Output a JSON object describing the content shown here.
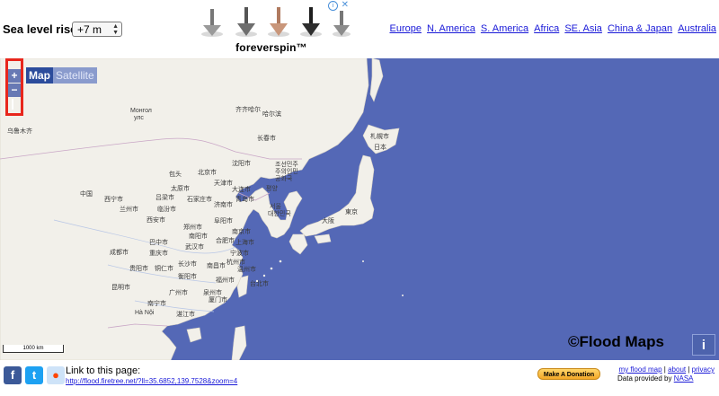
{
  "header": {
    "sea_level_label": "Sea level rise:",
    "sea_level_value": "+7 m",
    "ad_brand": "foreverspin™",
    "regions": [
      "Europe",
      "N. America",
      "S. America",
      "Africa",
      "SE. Asia",
      "China & Japan",
      "Australia"
    ]
  },
  "map": {
    "zoom_in": "+",
    "zoom_out": "−",
    "type_map": "Map",
    "type_satellite": "Satellite",
    "scale_label": "1000 km",
    "watermark": "©Flood Maps",
    "info": "i",
    "colors": {
      "water": "#5468b6",
      "land": "#f2f0ea",
      "highlight": "#e8261c"
    },
    "places": {
      "mongol": "Монгол",
      "mongol2": "улс",
      "qiqihar": "齐齐哈尔",
      "harbin": "哈尔滨",
      "urumqi": "乌鲁木齐",
      "changchun": "长春市",
      "shenyang": "沈阳市",
      "beijing": "北京市",
      "tianjin": "天津市",
      "dalian": "大连市",
      "korea_n": "조선민주",
      "korea_n2": "주의인민",
      "korea_n3": "공화국",
      "pyongyang": "평양",
      "seoul": "서울",
      "korea_s": "대한민국",
      "china": "中国",
      "xining": "西宁市",
      "lanzhou": "兰州市",
      "taiyuan": "太原市",
      "shijiazhuang": "石家庄市",
      "jinan": "济南市",
      "qingdao": "青岛市",
      "xian": "西安市",
      "zhengzhou": "郑州市",
      "nanjing": "南京市",
      "shanghai": "上海市",
      "wuhan": "武汉市",
      "hefei": "合肥市",
      "chongqing": "重庆市",
      "chengdu": "成都市",
      "changsha": "长沙市",
      "nanchang": "南昌市",
      "hangzhou": "杭州市",
      "guiyang": "贵阳市",
      "fuzhou": "福州市",
      "kunming": "昆明市",
      "guangzhou": "广州市",
      "nanning": "南宁市",
      "taipei": "台北市",
      "hanoi": "Hà Nội",
      "japan": "日本",
      "sapporo": "札幌市",
      "tokyo": "東京",
      "osaka": "大阪",
      "lanzhou2": "临汾市",
      "yinchuan": "吕梁市",
      "baotou": "包头",
      "zhanjiang": "湛江市",
      "shenzhen": "泉州市",
      "xiamen": "厦门市",
      "wenzhou": "温州市",
      "ningbo": "宁波市",
      "hengyang": "衡阳市",
      "zunyi": "铜仁市",
      "yichang": "巴中市",
      "nanyang": "南阳市",
      "lincang": "阜阳市"
    }
  },
  "footer": {
    "link_label": "Link to this page:",
    "link_url": "http://flood.firetree.net/?ll=35.6852,139.7528&zoom=4",
    "donate": "Make A Donation",
    "my_flood_map": "my flood map",
    "about": "about",
    "privacy": "privacy",
    "credit_prefix": "Data provided by",
    "nasa": "NASA"
  }
}
